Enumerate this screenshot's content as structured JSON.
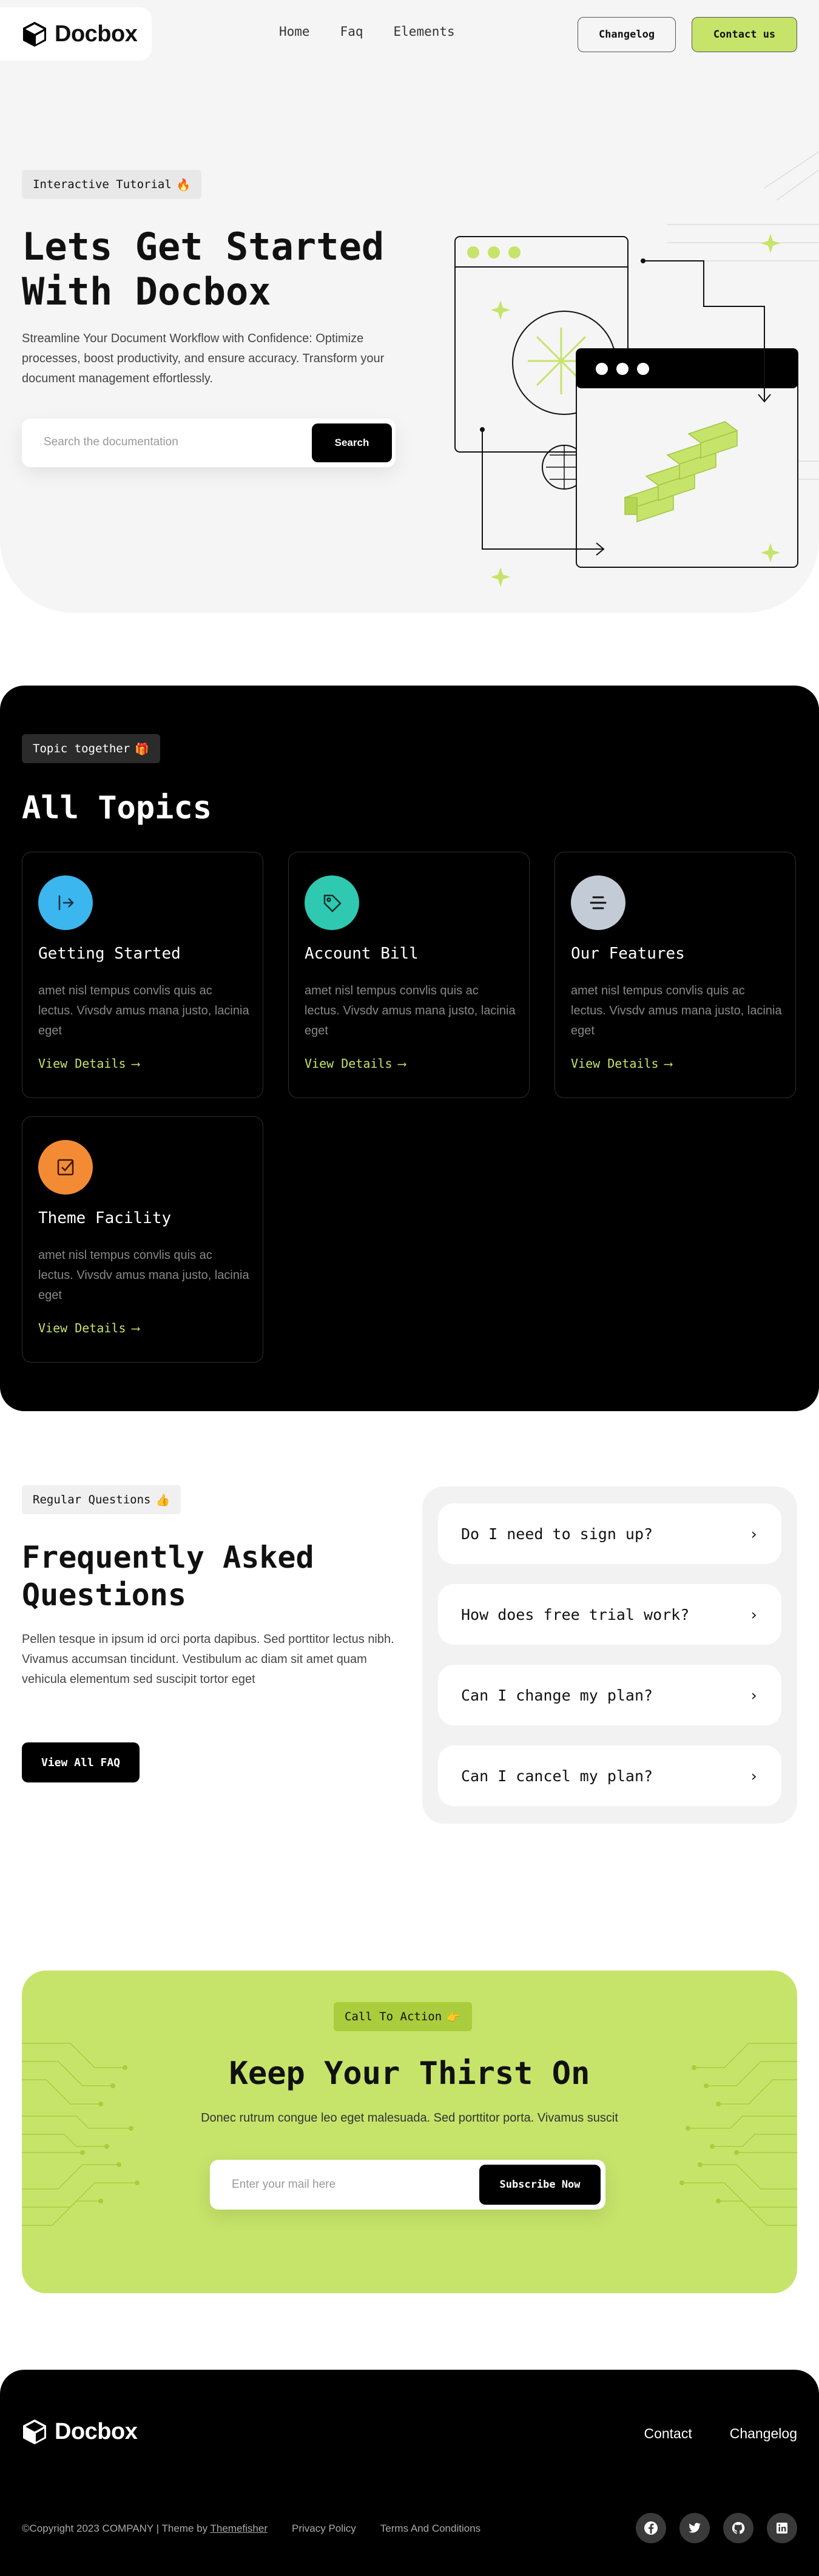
{
  "brand": {
    "name": "Docbox"
  },
  "nav": {
    "links": [
      "Home",
      "Faq",
      "Elements"
    ],
    "changelog_label": "Changelog",
    "contact_label": "Contact us"
  },
  "hero": {
    "badge": "Interactive Tutorial",
    "badge_emoji": "🔥",
    "title_line1": "Lets Get Started",
    "title_line2": "With Docbox",
    "description": "Streamline Your Document Workflow with Confidence: Optimize processes, boost productivity, and ensure accuracy. Transform your document management effortlessly.",
    "search_placeholder": "Search the documentation",
    "search_button": "Search"
  },
  "topics": {
    "badge": "Topic together",
    "badge_emoji": "🎁",
    "title": "All Topics",
    "cards": [
      {
        "title": "Getting Started",
        "desc": "amet nisl tempus convlis quis ac lectus. Vivsdv amus mana justo, lacinia eget",
        "link": "View Details",
        "icon": "sign-in-icon",
        "color": "#3bb6ee"
      },
      {
        "title": "Account Bill",
        "desc": "amet nisl tempus convlis quis ac lectus. Vivsdv amus mana justo, lacinia eget",
        "link": "View Details",
        "icon": "tag-icon",
        "color": "#2ec9b0"
      },
      {
        "title": "Our Features",
        "desc": "amet nisl tempus convlis quis ac lectus. Vivsdv amus mana justo, lacinia eget",
        "link": "View Details",
        "icon": "list-icon",
        "color": "#c3cbd6"
      },
      {
        "title": "Theme Facility",
        "desc": "amet nisl tempus convlis quis ac lectus. Vivsdv amus mana justo, lacinia eget",
        "link": "View Details",
        "icon": "checkbox-icon",
        "color": "#f38b35"
      }
    ]
  },
  "faq": {
    "badge": "Regular Questions",
    "badge_emoji": "👍",
    "title_line1": "Frequently Asked",
    "title_line2": "Questions",
    "description": "Pellen tesque in ipsum id orci porta dapibus. Sed porttitor lectus nibh. Vivamus accumsan tincidunt. Vestibulum ac diam sit amet quam vehicula elementum sed suscipit tortor eget",
    "button": "View All FAQ",
    "questions": [
      "Do I need to sign up?",
      "How does free trial work?",
      "Can I change my plan?",
      "Can I cancel my plan?"
    ]
  },
  "cta": {
    "badge": "Call To Action",
    "badge_emoji": "👉",
    "title": "Keep Your Thirst On",
    "description": "Donec rutrum congue leo eget malesuada. Sed porttitor porta. Vivamus suscit",
    "input_placeholder": "Enter your mail here",
    "button": "Subscribe Now"
  },
  "footer": {
    "links": [
      "Contact",
      "Changelog"
    ],
    "copyright": "©Copyright 2023 COMPANY | Theme by",
    "theme_author": "Themefisher",
    "privacy": "Privacy Policy",
    "terms": "Terms And Conditions",
    "socials": [
      "facebook-icon",
      "twitter-icon",
      "github-icon",
      "linkedin-icon"
    ]
  },
  "colors": {
    "accent": "#c6e46a",
    "dark": "#000000",
    "light_bg": "#f5f5f5"
  }
}
